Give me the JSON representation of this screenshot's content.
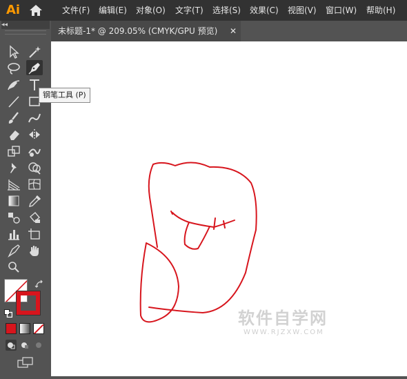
{
  "app": {
    "logo_text": "Ai"
  },
  "menu": [
    {
      "label": "文件(F)"
    },
    {
      "label": "编辑(E)"
    },
    {
      "label": "对象(O)"
    },
    {
      "label": "文字(T)"
    },
    {
      "label": "选择(S)"
    },
    {
      "label": "效果(C)"
    },
    {
      "label": "视图(V)"
    },
    {
      "label": "窗口(W)"
    },
    {
      "label": "帮助(H)"
    }
  ],
  "document_tab": {
    "title": "未标题-1* @ 209.05% (CMYK/GPU 预览)",
    "close_glyph": "✕"
  },
  "toolbar": {
    "collapse_glyph": "◂◂",
    "tooltip": "钢笔工具 (P)",
    "active_tool": "pen-tool",
    "fill_color": "#ffffff",
    "stroke_color": "#d7151d",
    "swatch_colors": [
      "#d7151d",
      "gradient",
      "none"
    ]
  },
  "artwork": {
    "stroke_color": "#d7151d",
    "background": "#ffffff"
  },
  "watermark": {
    "main": "软件自学网",
    "sub": "WWW.RJZXW.COM"
  }
}
